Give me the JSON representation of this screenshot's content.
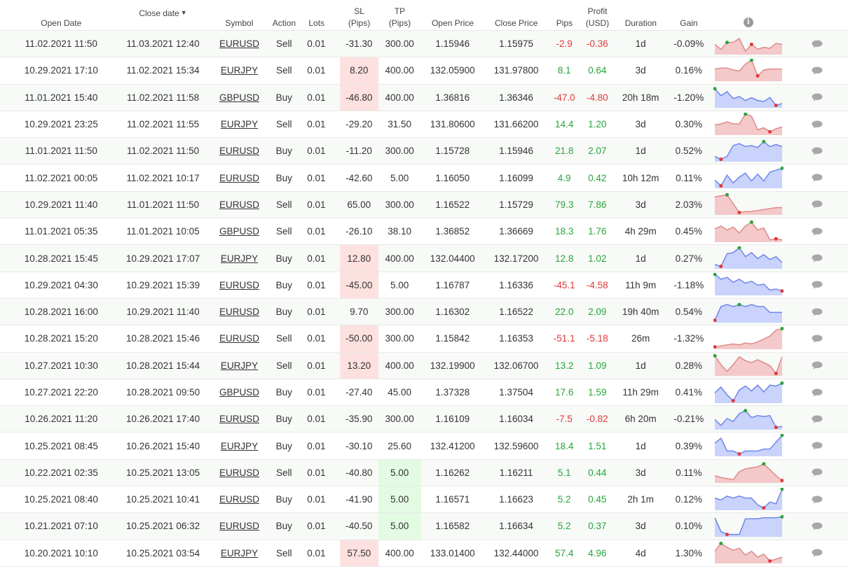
{
  "columns": {
    "open_date": "Open Date",
    "close_date": "Close date",
    "sort_indicator": "▼",
    "symbol": "Symbol",
    "action": "Action",
    "lots": "Lots",
    "sl_line1": "SL",
    "sl_line2": "(Pips)",
    "tp_line1": "TP",
    "tp_line2": "(Pips)",
    "open_price": "Open Price",
    "close_price": "Close Price",
    "pips": "Pips",
    "profit_line1": "Profit",
    "profit_line2": "(USD)",
    "duration": "Duration",
    "gain": "Gain",
    "info_icon": "i"
  },
  "colors": {
    "negative": "#e0383b",
    "positive": "#2aa33b",
    "sell_fill": "#f3c9c9",
    "sell_line": "#e08a8a",
    "buy_fill": "#c9d3fb",
    "buy_line": "#6f86ea",
    "max_marker": "#2aa33b",
    "min_marker": "#e0383b"
  },
  "trades": [
    {
      "open": "11.02.2021 11:50",
      "close": "11.03.2021 12:40",
      "symbol": "EURUSD",
      "action": "Sell",
      "lots": "0.01",
      "sl": "-31.30",
      "tp": "300.00",
      "open_price": "1.15946",
      "close_price": "1.15975",
      "pips": "-2.9",
      "profit": "-0.36",
      "duration": "1d",
      "gain": "-0.09%",
      "sl_hl": "",
      "tp_hl": "",
      "spark": [
        0.45,
        0.2,
        0.55,
        0.55,
        0.75,
        0.1,
        0.45,
        0.2,
        0.3,
        0.25,
        0.5,
        0.45
      ],
      "max": 2,
      "min": 6
    },
    {
      "open": "10.29.2021 17:10",
      "close": "11.02.2021 15:34",
      "symbol": "EURJPY",
      "action": "Sell",
      "lots": "0.01",
      "sl": "8.20",
      "tp": "400.00",
      "open_price": "132.05900",
      "close_price": "131.97800",
      "pips": "8.1",
      "profit": "0.64",
      "duration": "3d",
      "gain": "0.16%",
      "sl_hl": "red",
      "tp_hl": "",
      "spark": [
        0.55,
        0.6,
        0.6,
        0.5,
        0.45,
        0.8,
        1.0,
        0.2,
        0.5,
        0.55,
        0.55,
        0.55
      ],
      "max": 6,
      "min": 7
    },
    {
      "open": "11.01.2021 15:40",
      "close": "11.02.2021 11:58",
      "symbol": "GBPUSD",
      "action": "Buy",
      "lots": "0.01",
      "sl": "-46.80",
      "tp": "400.00",
      "open_price": "1.36816",
      "close_price": "1.36346",
      "pips": "-47.0",
      "profit": "-4.80",
      "duration": "20h 18m",
      "gain": "-1.20%",
      "sl_hl": "red",
      "tp_hl": "",
      "spark": [
        0.9,
        0.55,
        0.75,
        0.4,
        0.5,
        0.3,
        0.45,
        0.3,
        0.25,
        0.45,
        0.05,
        0.15
      ],
      "max": 0,
      "min": 10
    },
    {
      "open": "10.29.2021 23:25",
      "close": "11.02.2021 11:55",
      "symbol": "EURJPY",
      "action": "Sell",
      "lots": "0.01",
      "sl": "-29.20",
      "tp": "31.50",
      "open_price": "131.80600",
      "close_price": "131.66200",
      "pips": "14.4",
      "profit": "1.20",
      "duration": "3d",
      "gain": "0.30%",
      "sl_hl": "",
      "tp_hl": "",
      "spark": [
        0.45,
        0.5,
        0.6,
        0.5,
        0.5,
        1.0,
        0.9,
        0.2,
        0.3,
        0.1,
        0.25,
        0.35
      ],
      "max": 5,
      "min": 9
    },
    {
      "open": "11.01.2021 11:50",
      "close": "11.02.2021 11:50",
      "symbol": "EURUSD",
      "action": "Buy",
      "lots": "0.01",
      "sl": "-11.20",
      "tp": "300.00",
      "open_price": "1.15728",
      "close_price": "1.15946",
      "pips": "21.8",
      "profit": "2.07",
      "duration": "1d",
      "gain": "0.52%",
      "sl_hl": "",
      "tp_hl": "",
      "spark": [
        0.2,
        0.05,
        0.2,
        0.75,
        0.85,
        0.7,
        0.75,
        0.65,
        0.95,
        0.7,
        0.8,
        0.7
      ],
      "max": 8,
      "min": 1
    },
    {
      "open": "11.02.2021 00:05",
      "close": "11.02.2021 10:17",
      "symbol": "EURUSD",
      "action": "Buy",
      "lots": "0.01",
      "sl": "-42.60",
      "tp": "5.00",
      "open_price": "1.16050",
      "close_price": "1.16099",
      "pips": "4.9",
      "profit": "0.42",
      "duration": "10h 12m",
      "gain": "0.11%",
      "sl_hl": "",
      "tp_hl": "",
      "spark": [
        0.35,
        0.05,
        0.6,
        0.2,
        0.5,
        0.7,
        0.3,
        0.65,
        0.3,
        0.75,
        0.85,
        0.95
      ],
      "max": 11,
      "min": 1
    },
    {
      "open": "10.29.2021 11:40",
      "close": "11.01.2021 11:50",
      "symbol": "EURUSD",
      "action": "Sell",
      "lots": "0.01",
      "sl": "65.00",
      "tp": "300.00",
      "open_price": "1.16522",
      "close_price": "1.15729",
      "pips": "79.3",
      "profit": "7.86",
      "duration": "3d",
      "gain": "2.03%",
      "sl_hl": "",
      "tp_hl": "",
      "spark": [
        0.85,
        0.9,
        0.95,
        0.5,
        0.05,
        0.1,
        0.1,
        0.15,
        0.2,
        0.25,
        0.3,
        0.3
      ],
      "max": 2,
      "min": 4
    },
    {
      "open": "11.01.2021 05:35",
      "close": "11.01.2021 10:05",
      "symbol": "GBPUSD",
      "action": "Sell",
      "lots": "0.01",
      "sl": "-26.10",
      "tp": "38.10",
      "open_price": "1.36852",
      "close_price": "1.36669",
      "pips": "18.3",
      "profit": "1.76",
      "duration": "4h 29m",
      "gain": "0.45%",
      "sl_hl": "",
      "tp_hl": "",
      "spark": [
        0.6,
        0.75,
        0.55,
        0.7,
        0.4,
        0.75,
        0.95,
        0.55,
        0.65,
        0.05,
        0.1,
        0.05
      ],
      "max": 6,
      "min": 10
    },
    {
      "open": "10.28.2021 15:45",
      "close": "10.29.2021 17:07",
      "symbol": "EURJPY",
      "action": "Buy",
      "lots": "0.01",
      "sl": "12.80",
      "tp": "400.00",
      "open_price": "132.04400",
      "close_price": "132.17200",
      "pips": "12.8",
      "profit": "1.02",
      "duration": "1d",
      "gain": "0.27%",
      "sl_hl": "red",
      "tp_hl": "",
      "spark": [
        0.15,
        0.05,
        0.7,
        0.75,
        1.0,
        0.55,
        0.75,
        0.45,
        0.65,
        0.4,
        0.55,
        0.25
      ],
      "max": 4,
      "min": 1
    },
    {
      "open": "10.29.2021 04:30",
      "close": "10.29.2021 15:39",
      "symbol": "EURUSD",
      "action": "Buy",
      "lots": "0.01",
      "sl": "-45.00",
      "tp": "5.00",
      "open_price": "1.16787",
      "close_price": "1.16336",
      "pips": "-45.1",
      "profit": "-4.58",
      "duration": "11h 9m",
      "gain": "-1.18%",
      "sl_hl": "red",
      "tp_hl": "",
      "spark": [
        1.0,
        0.75,
        0.85,
        0.6,
        0.75,
        0.55,
        0.65,
        0.45,
        0.5,
        0.2,
        0.25,
        0.15
      ],
      "max": 0,
      "min": 11
    },
    {
      "open": "10.28.2021 16:00",
      "close": "10.29.2021 11:40",
      "symbol": "EURUSD",
      "action": "Buy",
      "lots": "0.01",
      "sl": "9.70",
      "tp": "300.00",
      "open_price": "1.16302",
      "close_price": "1.16522",
      "pips": "22.0",
      "profit": "2.09",
      "duration": "19h 40m",
      "gain": "0.54%",
      "sl_hl": "",
      "tp_hl": "",
      "spark": [
        0.05,
        0.75,
        0.85,
        0.75,
        0.85,
        0.75,
        0.85,
        0.75,
        0.75,
        0.45,
        0.45,
        0.45
      ],
      "max": 4,
      "min": 0
    },
    {
      "open": "10.28.2021 15:20",
      "close": "10.28.2021 15:46",
      "symbol": "EURUSD",
      "action": "Sell",
      "lots": "0.01",
      "sl": "-50.00",
      "tp": "300.00",
      "open_price": "1.15842",
      "close_price": "1.16353",
      "pips": "-51.1",
      "profit": "-5.18",
      "duration": "26m",
      "gain": "-1.32%",
      "sl_hl": "red",
      "tp_hl": "",
      "spark": [
        0.05,
        0.1,
        0.15,
        0.2,
        0.15,
        0.25,
        0.2,
        0.3,
        0.45,
        0.6,
        0.9,
        0.98
      ],
      "max": 11,
      "min": 0
    },
    {
      "open": "10.27.2021 10:30",
      "close": "10.28.2021 15:44",
      "symbol": "EURJPY",
      "action": "Sell",
      "lots": "0.01",
      "sl": "13.20",
      "tp": "400.00",
      "open_price": "132.19900",
      "close_price": "132.06700",
      "pips": "13.2",
      "profit": "1.09",
      "duration": "1d",
      "gain": "0.28%",
      "sl_hl": "red",
      "tp_hl": "",
      "spark": [
        0.95,
        0.5,
        0.15,
        0.5,
        0.9,
        0.7,
        0.6,
        0.75,
        0.6,
        0.45,
        0.05,
        0.9
      ],
      "max": 0,
      "min": 10
    },
    {
      "open": "10.27.2021 22:20",
      "close": "10.28.2021 09:50",
      "symbol": "GBPUSD",
      "action": "Buy",
      "lots": "0.01",
      "sl": "-27.40",
      "tp": "45.00",
      "open_price": "1.37328",
      "close_price": "1.37504",
      "pips": "17.6",
      "profit": "1.59",
      "duration": "11h 29m",
      "gain": "0.41%",
      "sl_hl": "",
      "tp_hl": "",
      "spark": [
        0.45,
        0.75,
        0.35,
        0.05,
        0.6,
        0.8,
        0.55,
        0.85,
        0.5,
        0.85,
        0.8,
        0.95
      ],
      "max": 11,
      "min": 3
    },
    {
      "open": "10.26.2021 11:20",
      "close": "10.26.2021 17:40",
      "symbol": "EURUSD",
      "action": "Buy",
      "lots": "0.01",
      "sl": "-35.90",
      "tp": "300.00",
      "open_price": "1.16109",
      "close_price": "1.16034",
      "pips": "-7.5",
      "profit": "-0.82",
      "duration": "6h 20m",
      "gain": "-0.21%",
      "sl_hl": "",
      "tp_hl": "",
      "spark": [
        0.45,
        0.15,
        0.5,
        0.35,
        0.75,
        0.9,
        0.55,
        0.65,
        0.6,
        0.65,
        0.05,
        0.1
      ],
      "max": 5,
      "min": 10
    },
    {
      "open": "10.25.2021 08:45",
      "close": "10.26.2021 15:40",
      "symbol": "EURJPY",
      "action": "Buy",
      "lots": "0.01",
      "sl": "-30.10",
      "tp": "25.60",
      "open_price": "132.41200",
      "close_price": "132.59600",
      "pips": "18.4",
      "profit": "1.51",
      "duration": "1d",
      "gain": "0.39%",
      "sl_hl": "",
      "tp_hl": "",
      "spark": [
        0.6,
        0.85,
        0.2,
        0.2,
        0.05,
        0.2,
        0.2,
        0.2,
        0.3,
        0.3,
        0.65,
        1.0
      ],
      "max": 11,
      "min": 4
    },
    {
      "open": "10.22.2021 02:35",
      "close": "10.25.2021 13:05",
      "symbol": "EURUSD",
      "action": "Sell",
      "lots": "0.01",
      "sl": "-40.80",
      "tp": "5.00",
      "open_price": "1.16262",
      "close_price": "1.16211",
      "pips": "5.1",
      "profit": "0.44",
      "duration": "3d",
      "gain": "0.11%",
      "sl_hl": "",
      "tp_hl": "green",
      "spark": [
        0.3,
        0.2,
        0.15,
        0.1,
        0.5,
        0.65,
        0.7,
        0.75,
        0.9,
        0.6,
        0.3,
        0.05
      ],
      "max": 8,
      "min": 11
    },
    {
      "open": "10.25.2021 08:40",
      "close": "10.25.2021 10:41",
      "symbol": "EURUSD",
      "action": "Buy",
      "lots": "0.01",
      "sl": "-41.90",
      "tp": "5.00",
      "open_price": "1.16571",
      "close_price": "1.16623",
      "pips": "5.2",
      "profit": "0.45",
      "duration": "2h 1m",
      "gain": "0.12%",
      "sl_hl": "",
      "tp_hl": "green",
      "spark": [
        0.55,
        0.45,
        0.65,
        0.55,
        0.65,
        0.55,
        0.55,
        0.2,
        0.05,
        0.35,
        0.25,
        1.0
      ],
      "max": 11,
      "min": 8
    },
    {
      "open": "10.21.2021 07:10",
      "close": "10.25.2021 06:32",
      "symbol": "EURUSD",
      "action": "Buy",
      "lots": "0.01",
      "sl": "-40.50",
      "tp": "5.00",
      "open_price": "1.16582",
      "close_price": "1.16634",
      "pips": "5.2",
      "profit": "0.37",
      "duration": "3d",
      "gain": "0.10%",
      "sl_hl": "",
      "tp_hl": "green",
      "spark": [
        0.9,
        0.2,
        0.05,
        0.05,
        0.05,
        0.85,
        0.85,
        0.85,
        0.9,
        0.9,
        0.9,
        0.95
      ],
      "max": 11,
      "min": 2
    },
    {
      "open": "10.20.2021 10:10",
      "close": "10.25.2021 03:54",
      "symbol": "EURJPY",
      "action": "Sell",
      "lots": "0.01",
      "sl": "57.50",
      "tp": "400.00",
      "open_price": "133.01400",
      "close_price": "132.44000",
      "pips": "57.4",
      "profit": "4.96",
      "duration": "4d",
      "gain": "1.30%",
      "sl_hl": "red",
      "tp_hl": "",
      "spark": [
        0.55,
        0.95,
        0.75,
        0.6,
        0.7,
        0.35,
        0.55,
        0.25,
        0.4,
        0.05,
        0.15,
        0.25
      ],
      "max": 1,
      "min": 9
    }
  ]
}
